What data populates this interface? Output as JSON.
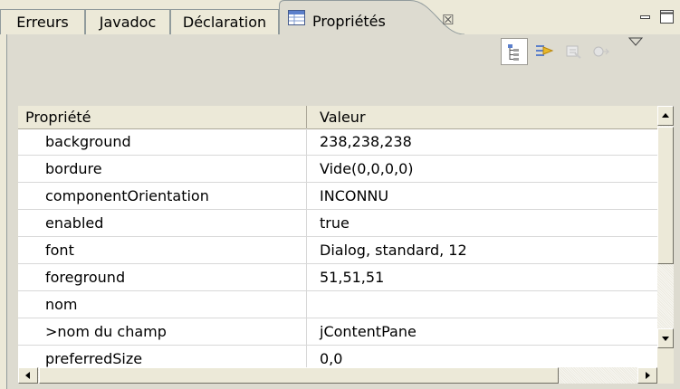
{
  "tabs": [
    {
      "label": "Erreurs"
    },
    {
      "label": "Javadoc"
    },
    {
      "label": "Déclaration"
    },
    {
      "label": "Propriétés",
      "close": "☒"
    }
  ],
  "table": {
    "headers": [
      "Propriété",
      "Valeur"
    ],
    "rows": [
      {
        "name": "background",
        "value": "238,238,238"
      },
      {
        "name": "bordure",
        "value": "Vide(0,0,0,0)"
      },
      {
        "name": "componentOrientation",
        "value": "INCONNU"
      },
      {
        "name": "enabled",
        "value": "true"
      },
      {
        "name": "font",
        "value": "Dialog, standard, 12"
      },
      {
        "name": "foreground",
        "value": "51,51,51"
      },
      {
        "name": "nom",
        "value": ""
      },
      {
        "name": ">nom du champ",
        "value": "jContentPane"
      },
      {
        "name": "preferredSize",
        "value": "0,0"
      }
    ]
  },
  "icons": {
    "tab": "properties-grid-icon",
    "toolbar": [
      "show-categories-icon",
      "show-advanced-icon",
      "restore-default-icon",
      "filter-icon",
      "view-menu-icon"
    ],
    "window": [
      "minimize-icon",
      "maximize-icon"
    ]
  }
}
